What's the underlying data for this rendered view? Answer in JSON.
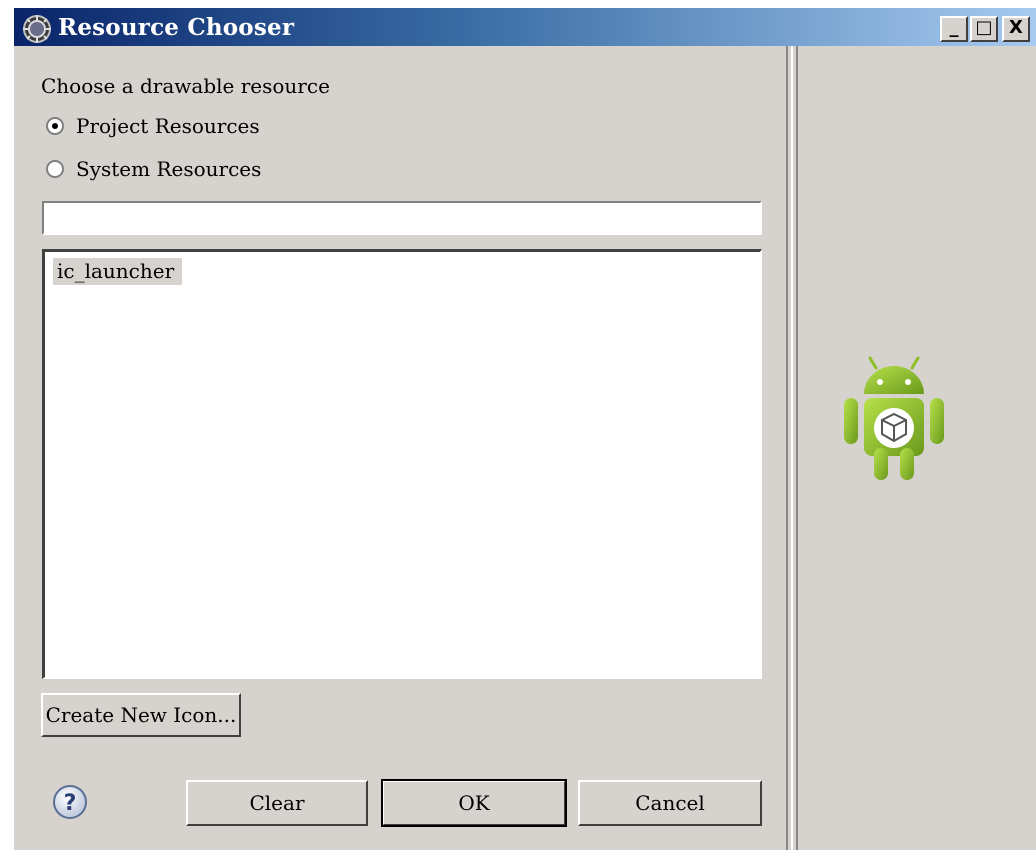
{
  "window": {
    "title": "Resource Chooser",
    "title_icon": "eclipse-gear-icon",
    "controls": {
      "minimize": "_",
      "maximize": "□",
      "close": "X"
    }
  },
  "chooser": {
    "prompt": "Choose a drawable resource",
    "options": [
      {
        "label": "Project Resources",
        "selected": true
      },
      {
        "label": "System Resources",
        "selected": false
      }
    ],
    "filter": {
      "value": "",
      "placeholder": ""
    },
    "items": [
      {
        "label": "ic_launcher",
        "selected": true
      }
    ],
    "create_button": "Create New Icon..."
  },
  "footer": {
    "help_icon": "question-mark-icon",
    "clear_label": "Clear",
    "ok_label": "OK",
    "cancel_label": "Cancel"
  },
  "preview": {
    "icon": "android-launcher-icon"
  },
  "colors": {
    "dialog_bg": "#d6d3ce",
    "title_gradient_start": "#0a246a",
    "title_gradient_end": "#a6caf0",
    "android_green": "#8cbf26"
  }
}
